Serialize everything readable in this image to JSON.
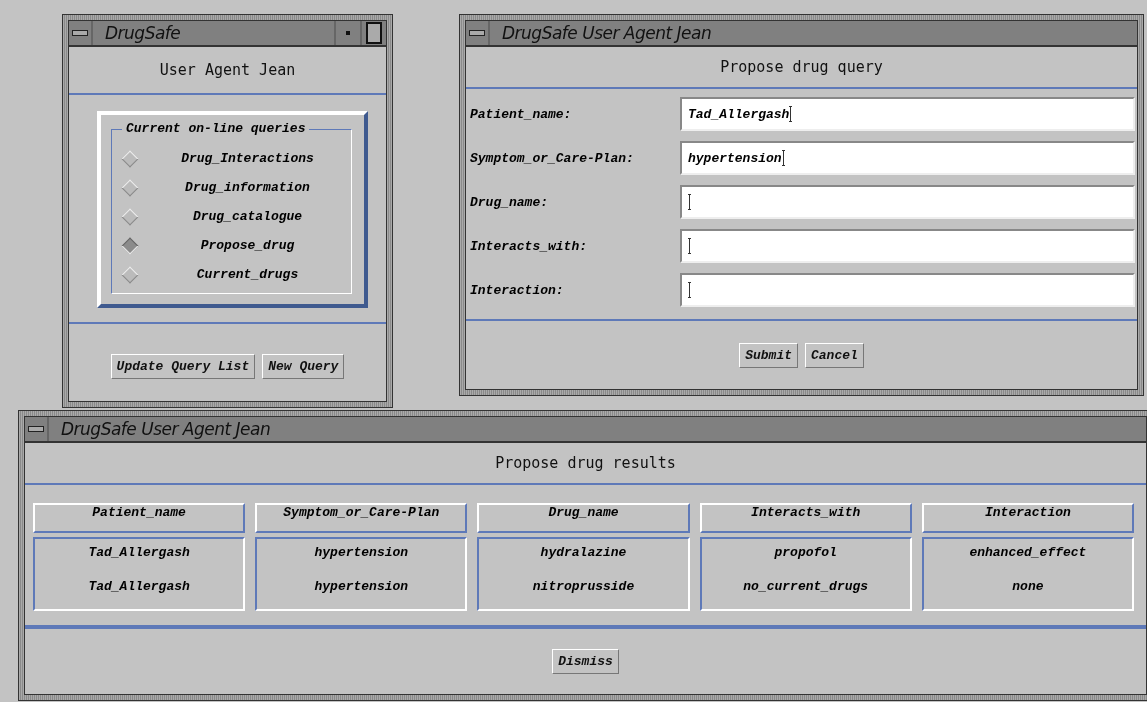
{
  "query_list_window": {
    "title": "DrugSafe",
    "heading": "User Agent Jean",
    "group_label": "Current on-line queries",
    "queries": [
      {
        "label": "Drug_Interactions",
        "selected": false
      },
      {
        "label": "Drug_information",
        "selected": false
      },
      {
        "label": "Drug_catalogue",
        "selected": false
      },
      {
        "label": "Propose_drug",
        "selected": true
      },
      {
        "label": "Current_drugs",
        "selected": false
      }
    ],
    "buttons": [
      "Update Query List",
      "New Query"
    ]
  },
  "query_window": {
    "title": "DrugSafe User Agent Jean",
    "heading": "Propose drug query",
    "fields": [
      {
        "label": "Patient_name:",
        "value": "Tad_Allergash"
      },
      {
        "label": "Symptom_or_Care-Plan:",
        "value": "hypertension"
      },
      {
        "label": "Drug_name:"
      },
      {
        "label": "Interacts_with:"
      },
      {
        "label": "Interaction:"
      }
    ],
    "buttons": [
      "Submit",
      "Cancel"
    ]
  },
  "results_window": {
    "title": "DrugSafe User Agent Jean",
    "heading": "Propose drug results",
    "table": {
      "columns": [
        "Patient_name",
        "Symptom_or_Care-Plan",
        "Drug_name",
        "Interacts_with",
        "Interaction"
      ],
      "rows": [
        [
          "Tad_Allergash",
          "hypertension",
          "hydralazine",
          "propofol",
          "enhanced_effect"
        ],
        [
          "Tad_Allergash",
          "hypertension",
          "nitroprusside",
          "no_current_drugs",
          "none"
        ]
      ]
    },
    "buttons": [
      "Dismiss"
    ]
  }
}
